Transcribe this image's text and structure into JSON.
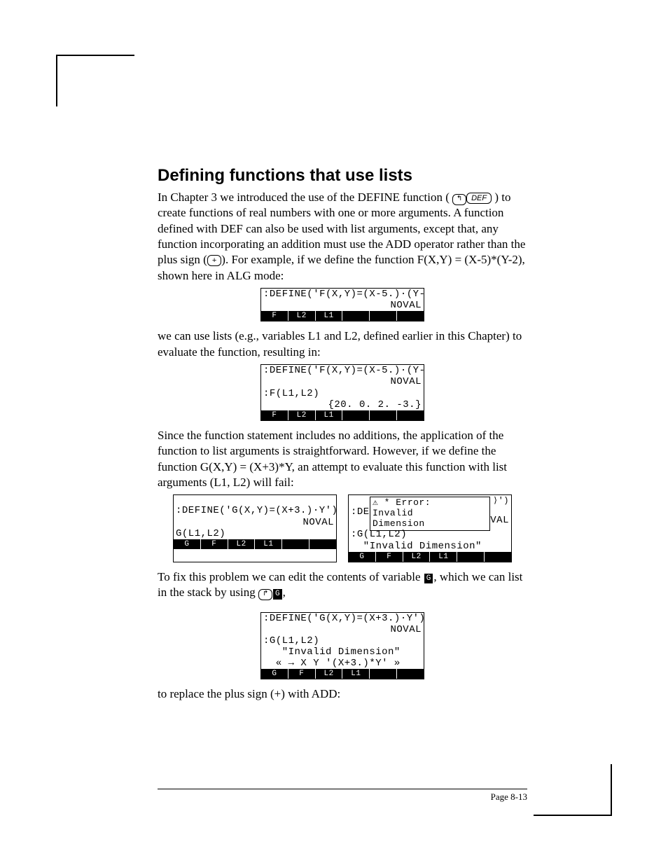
{
  "title": "Defining functions that use lists",
  "p1a": "In Chapter 3 we introduced the use of the DEFINE function ( ",
  "key_left": "↰",
  "key_def": "DEF",
  "p1b": " ) to create functions of real numbers with one or more arguments.  A function defined with DEF can also be used with list arguments, except that, any function incorporating an addition must use the ADD operator rather than the plus sign (",
  "key_plus": "+",
  "p1c": ").  For example, if we define the function F(X,Y) = (X-5)*(Y-2), shown here in ALG mode:",
  "screen1": {
    "l1": ":DEFINE('F(X,Y)=(X-5.)·(Y-",
    "l2r": "NOVAL",
    "menus": [
      "F",
      "L2",
      "L1",
      "",
      "",
      ""
    ]
  },
  "p2": "we can use lists (e.g., variables L1 and L2, defined earlier in this Chapter) to evaluate the function, resulting in:",
  "screen2": {
    "l1": ":DEFINE('F(X,Y)=(X-5.)·(Y-",
    "l2r": "NOVAL",
    "l3": ":F(L1,L2)",
    "l4r": "{20. 0. 2. -3.}",
    "menus": [
      "F",
      "L2",
      "L1",
      "",
      "",
      ""
    ]
  },
  "p3": "Since the function statement includes no additions, the application of the function to list arguments is straightforward.  However, if we define the function G(X,Y) = (X+3)*Y, an attempt to evaluate this function with list arguments (L1, L2) will fail:",
  "screen3a": {
    "l1": ":DEFINE('G(X,Y)=(X+3.)·Y')",
    "l2r": "NOVAL",
    "l3": "G(L1,L2)",
    "menus": [
      "G",
      "F",
      "L2",
      "L1",
      "",
      ""
    ]
  },
  "screen3b": {
    "pre": ":DE",
    "post": "VAL",
    "post2": "⟩')",
    "err1": "⚠ * Error:",
    "err2": "  Invalid",
    "err3": "  Dimension",
    "l3": ":G(L1,L2)",
    "l4": "  \"Invalid Dimension\"",
    "menus": [
      "G",
      "F",
      "L2",
      "L1",
      "",
      ""
    ]
  },
  "p4a": "To fix this problem we can edit the contents of variable ",
  "soft_g1": "G",
  "p4b": ", which we can list in the stack by using ",
  "key_right": "↱",
  "soft_g2": "G",
  "p4c": ",",
  "screen4": {
    "l1": ":DEFINE('G(X,Y)=(X+3.)·Y')",
    "l2r": "NOVAL",
    "l3": ":G(L1,L2)",
    "l4": "   \"Invalid Dimension\"",
    "l5": "  « → X Y '(X+3.)*Y' »",
    "menus": [
      "G",
      "F",
      "L2",
      "L1",
      "",
      ""
    ]
  },
  "p5": "to replace the plus sign (+) with ADD:",
  "footer": "Page 8-13"
}
